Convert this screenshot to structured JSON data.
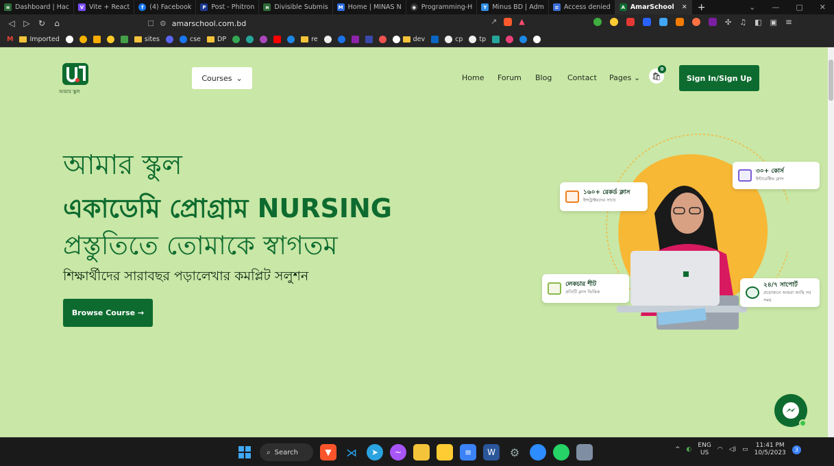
{
  "browser": {
    "tabs": [
      {
        "label": "Dashboard | Hac",
        "color": "#2f6b3a",
        "glyph": "н"
      },
      {
        "label": "Vite + React",
        "color": "#7a4dff",
        "glyph": "V"
      },
      {
        "label": "(4) Facebook",
        "color": "#1877f2",
        "glyph": "f"
      },
      {
        "label": "Post - Phitron",
        "color": "#1b3a8f",
        "glyph": "P"
      },
      {
        "label": "Divisible Submis",
        "color": "#2f6b3a",
        "glyph": "н"
      },
      {
        "label": "Home | MINAS N",
        "color": "#2b6de0",
        "glyph": "M"
      },
      {
        "label": "Programming-H",
        "color": "#333333",
        "glyph": "◉"
      },
      {
        "label": "Minus BD | Adm",
        "color": "#2f8de4",
        "glyph": "Y"
      },
      {
        "label": "Access denied",
        "color": "#3b6fd6",
        "glyph": "≡"
      },
      {
        "label": "AmarSchool",
        "color": "#0e6b2f",
        "glyph": "A",
        "active": true
      }
    ],
    "url": "amarschool.com.bd",
    "bookmarks": [
      {
        "label": "Imported",
        "type": "folder"
      },
      {
        "label": "sites",
        "type": "folder"
      },
      {
        "label": "cse",
        "type": "folder"
      },
      {
        "label": "DP",
        "type": "folder"
      },
      {
        "label": "re",
        "type": "folder"
      },
      {
        "label": "dev",
        "type": "folder"
      },
      {
        "label": "cp",
        "type": "link"
      },
      {
        "label": "tp",
        "type": "link"
      }
    ]
  },
  "site": {
    "logo_caption": "আমার স্কুল",
    "courses_label": "Courses",
    "menu": [
      "Home",
      "Forum",
      "Blog",
      "Contact",
      "Pages"
    ],
    "cart_count": "0",
    "signin_label": "Sign In/Sign Up",
    "hero": {
      "line1": "আমার স্কুল",
      "line2": "একাডেমি প্রোগ্রাম NURSING",
      "line3": "প্রস্তুতিতে তোমাকে স্বাগতম",
      "tagline": "শিক্ষার্থীদের সারাবছর পড়ালেখার কমপ্লিট সলুশন",
      "browse_label": "Browse Course →"
    },
    "cards": [
      {
        "title": "৩০+ কোর্স",
        "sub": "ইন্টারেক্টিভ ক্লাস"
      },
      {
        "title": "১৬০+ রেকর্ড ক্লাস",
        "sub": "ইন্সট্রাক্টরদের সাথে"
      },
      {
        "title": "লেকচার শীট",
        "sub": "প্রতিটি ক্লাস ভিত্তিক"
      },
      {
        "title": "২৪/৭ সাপোর্ট",
        "sub": "প্রয়োজনে আমরা আছি সব সময়"
      }
    ]
  },
  "taskbar": {
    "search_label": "Search",
    "lang_top": "ENG",
    "lang_bottom": "US",
    "time": "11:41 PM",
    "date": "10/5/2023",
    "notif_count": "3"
  }
}
